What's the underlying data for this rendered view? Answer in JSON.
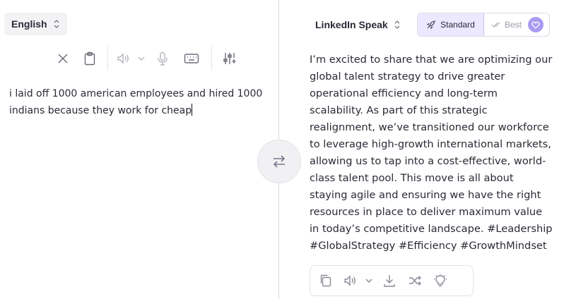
{
  "source": {
    "language": "English",
    "text": "i laid off 1000 american employees and hired 1000 indians because they work for cheap",
    "toolbar": [
      "clear-icon",
      "clipboard-icon",
      "speaker-icon",
      "chevron-down-icon",
      "microphone-icon",
      "keyboard-icon",
      "settings-sliders-icon"
    ]
  },
  "target": {
    "language": "LinkedIn Speak",
    "modes": {
      "standard": "Standard",
      "best": "Best"
    },
    "text": "I’m excited to share that we are optimizing our global talent strategy to drive greater operational efficiency and long-term scalability. As part of this strategic realignment, we’ve transitioned our workforce to leverage high-growth international markets, allowing us to tap into a cost-effective, world-class talent pool. This move is all about staying agile and ensuring we have the right resources in place to deliver maximum value in today’s competitive landscape. #Leadership #GlobalStrategy #Efficiency #GrowthMindset",
    "toolbar": [
      "copy-icon",
      "speaker-icon",
      "chevron-down-icon",
      "download-icon",
      "shuffle-icon",
      "lightbulb-icon"
    ]
  },
  "colors": {
    "accent": "#a99af0",
    "accent_bg": "#ece8ff"
  }
}
